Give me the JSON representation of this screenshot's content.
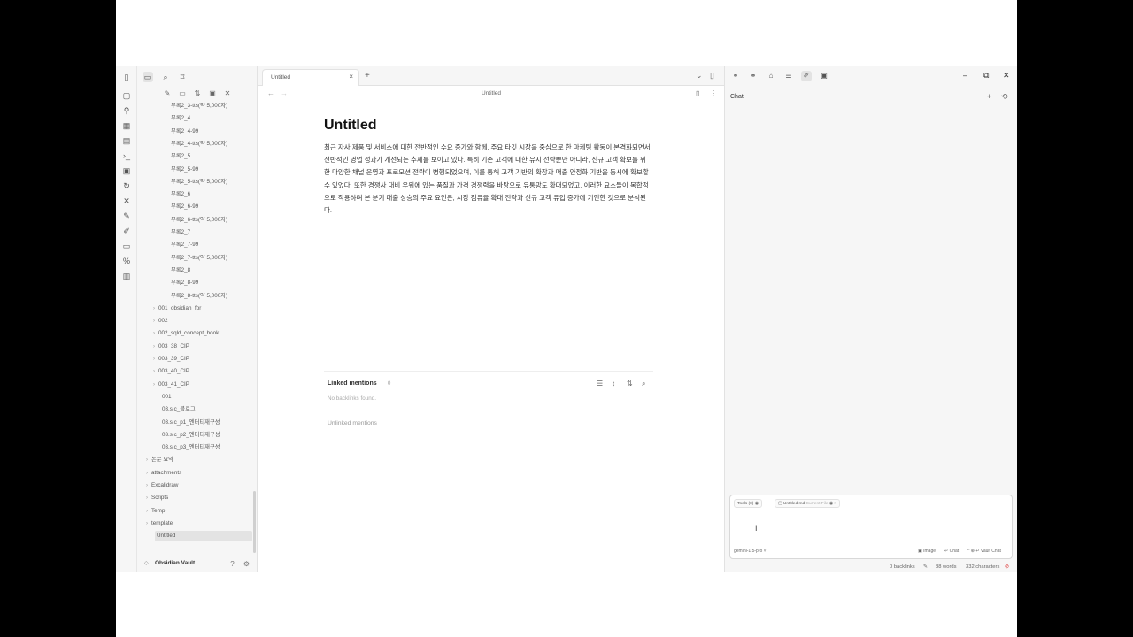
{
  "ribbon_icons": [
    "files-icon",
    "graph-icon",
    "canvas-icon",
    "calendar-icon",
    "terminal-icon",
    "template-icon",
    "sync-icon",
    "tools-icon",
    "plugin-icon",
    "excalidraw-icon",
    "slides-icon",
    "percent-icon",
    "book-icon"
  ],
  "sidebar": {
    "tree": [
      {
        "label": "부록2_3-tts(약 5,000자)",
        "depth": 2
      },
      {
        "label": "부록2_4",
        "depth": 2
      },
      {
        "label": "부록2_4-99",
        "depth": 2
      },
      {
        "label": "부록2_4-tts(약 5,000자)",
        "depth": 2
      },
      {
        "label": "부록2_5",
        "depth": 2
      },
      {
        "label": "부록2_5-99",
        "depth": 2
      },
      {
        "label": "부록2_5-tts(약 5,000자)",
        "depth": 2
      },
      {
        "label": "부록2_6",
        "depth": 2
      },
      {
        "label": "부록2_6-99",
        "depth": 2
      },
      {
        "label": "부록2_6-tts(약 5,000자)",
        "depth": 2
      },
      {
        "label": "부록2_7",
        "depth": 2
      },
      {
        "label": "부록2_7-99",
        "depth": 2
      },
      {
        "label": "부록2_7-tts(약 5,000자)",
        "depth": 2
      },
      {
        "label": "부록2_8",
        "depth": 2
      },
      {
        "label": "부록2_8-99",
        "depth": 2
      },
      {
        "label": "부록2_8-tts(약 5,000자)",
        "depth": 2
      },
      {
        "label": "001_obsidian_for",
        "depth": 1,
        "folder": true
      },
      {
        "label": "002",
        "depth": 1,
        "folder": true
      },
      {
        "label": "002_sqld_concept_book",
        "depth": 1,
        "folder": true
      },
      {
        "label": "003_38_CIP",
        "depth": 1,
        "folder": true
      },
      {
        "label": "003_39_CIP",
        "depth": 1,
        "folder": true
      },
      {
        "label": "003_40_CIP",
        "depth": 1,
        "folder": true
      },
      {
        "label": "003_41_CIP",
        "depth": 1,
        "folder": true
      },
      {
        "label": "001",
        "depth": 1
      },
      {
        "label": "03.s.c_블로그",
        "depth": 1
      },
      {
        "label": "03.s.c_p1_엔터티재구성",
        "depth": 1
      },
      {
        "label": "03.s.c_p2_엔터티재구성",
        "depth": 1
      },
      {
        "label": "03.s.c_p3_엔터티재구성",
        "depth": 1
      },
      {
        "label": "논문 요약",
        "depth": 0,
        "folder": true
      },
      {
        "label": "attachments",
        "depth": 0,
        "folder": true
      },
      {
        "label": "Excalidraw",
        "depth": 0,
        "folder": true
      },
      {
        "label": "Scripts",
        "depth": 0,
        "folder": true
      },
      {
        "label": "Temp",
        "depth": 0,
        "folder": true
      },
      {
        "label": "template",
        "depth": 0,
        "folder": true
      },
      {
        "label": "Untitled",
        "depth": 0,
        "selected": true
      }
    ],
    "vault_name": "Obsidian Vault"
  },
  "editor": {
    "tab_label": "Untitled",
    "header_title": "Untitled",
    "doc_title": "Untitled",
    "doc_body": "최근 자사 제품 및 서비스에 대한 전반적인 수요 증가와 함께, 주요 타깃 시장을 중심으로 한 마케팅 활동이 본격화되면서 전반적인 영업 성과가 개선되는 추세를 보이고 있다. 특히 기존 고객에 대한 유지 전략뿐만 아니라, 신규 고객 확보를 위한 다양한 채널 운영과 프로모션 전략이 병행되었으며, 이를 통해 고객 기반의 확장과 매출 안정화 기반을 동시에 확보할 수 있었다. 또한 경쟁사 대비 우위에 있는 품질과 가격 경쟁력을 바탕으로 유통망도 확대되었고, 이러한 요소들이 복합적으로 작용하며 본 분기 매출 상승의 주요 요인은, 시장 점유율 확대 전략과 신규 고객 유입 증가에 기인한 것으로 분석된다.",
    "linked_mentions": "Linked mentions",
    "linked_count": "0",
    "no_backlinks": "No backlinks found.",
    "unlinked_mentions": "Unlinked mentions"
  },
  "right_panel": {
    "chat_label": "Chat",
    "chip_tools": "Tools (0)",
    "chip_file": "Untitled.md",
    "chip_file_note": "Current File",
    "model": "gemini-1.5-pro ˅",
    "action_image": "Image",
    "action_chat": "↵ Chat",
    "action_vault": "^ ⊕ ↵ Vault Chat"
  },
  "status": {
    "backlinks": "0 backlinks",
    "words": "88 words",
    "characters": "332 characters"
  }
}
